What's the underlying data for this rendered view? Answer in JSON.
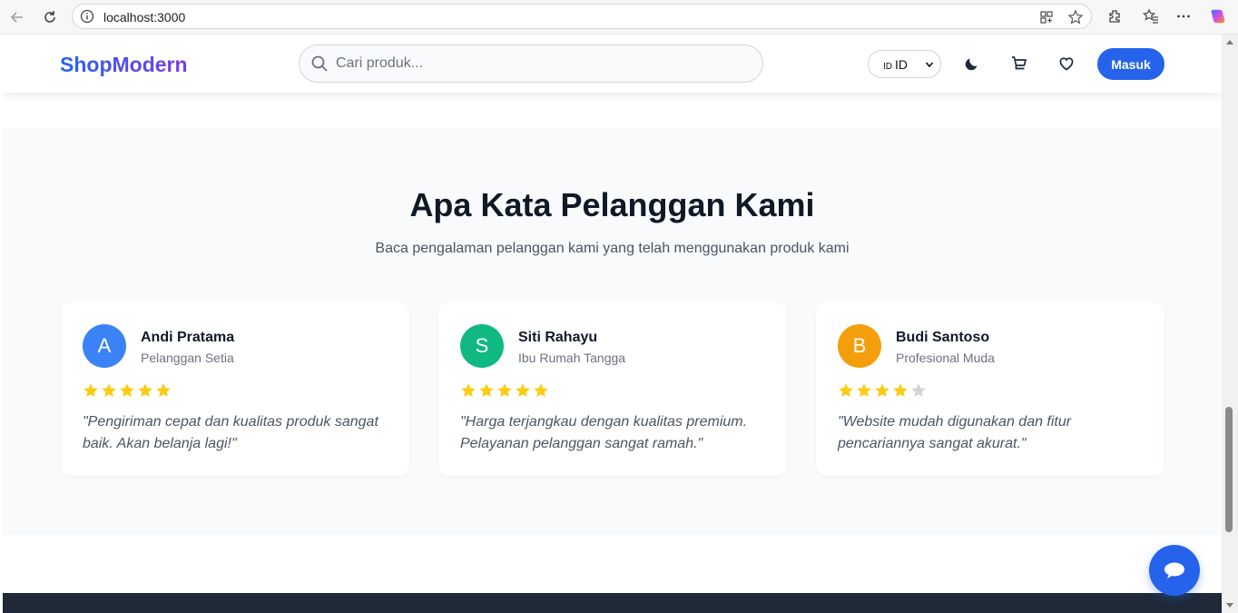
{
  "browser": {
    "url": "localhost:3000"
  },
  "header": {
    "logo": "ShopModern",
    "search_placeholder": "Cari produk...",
    "language": {
      "flag": "ID",
      "code": "ID"
    },
    "login_label": "Masuk"
  },
  "testimonials": {
    "title": "Apa Kata Pelanggan Kami",
    "subtitle": "Baca pengalaman pelanggan kami yang telah menggunakan produk kami",
    "items": [
      {
        "initial": "A",
        "name": "Andi Pratama",
        "role": "Pelanggan Setia",
        "rating": 5,
        "quote": "\"Pengiriman cepat dan kualitas produk sangat baik. Akan belanja lagi!\"",
        "color": "#3b82f6"
      },
      {
        "initial": "S",
        "name": "Siti Rahayu",
        "role": "Ibu Rumah Tangga",
        "rating": 5,
        "quote": "\"Harga terjangkau dengan kualitas premium. Pelayanan pelanggan sangat ramah.\"",
        "color": "#10b981"
      },
      {
        "initial": "B",
        "name": "Budi Santoso",
        "role": "Profesional Muda",
        "rating": 4,
        "quote": "\"Website mudah digunakan dan fitur pencariannya sangat akurat.\"",
        "color": "#f59e0b"
      }
    ]
  },
  "colors": {
    "primary": "#2563eb",
    "star": "#facc15",
    "star_empty": "#d1d5db",
    "footer": "#1f2937"
  }
}
